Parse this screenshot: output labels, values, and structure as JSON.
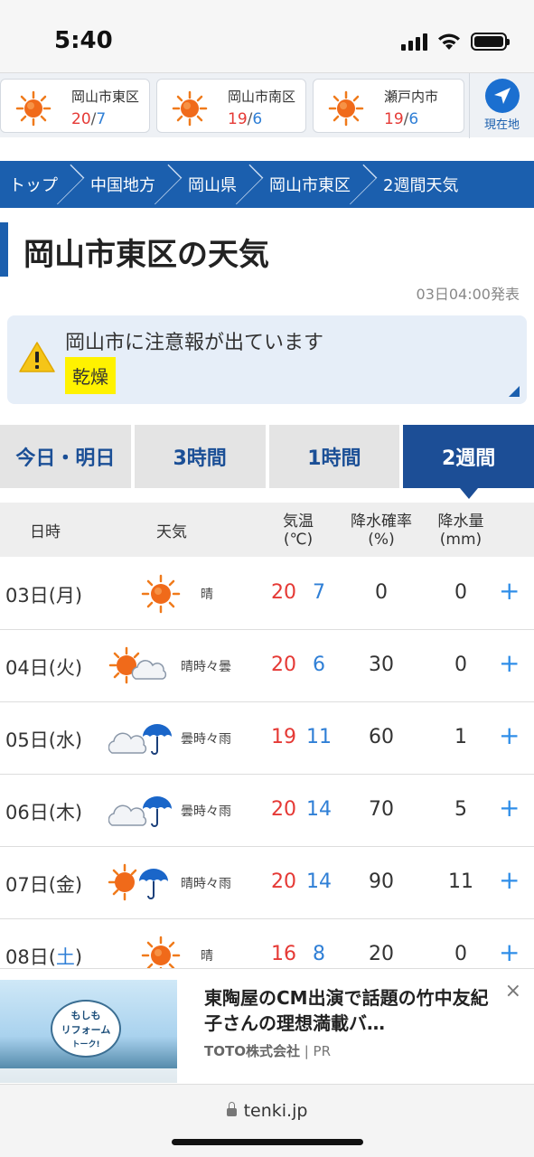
{
  "status_bar": {
    "time": "5:40"
  },
  "locations": [
    {
      "name": "岡山市東区",
      "high": "20",
      "low": "7"
    },
    {
      "name": "岡山市南区",
      "high": "19",
      "low": "6"
    },
    {
      "name": "瀬戸内市",
      "high": "19",
      "low": "6"
    }
  ],
  "current_location_label": "現在地",
  "breadcrumb": [
    "トップ",
    "中国地方",
    "岡山県",
    "岡山市東区",
    "2週間天気"
  ],
  "page_title": "岡山市東区の天気",
  "published": "03日04:00発表",
  "warning": {
    "message": "岡山市に注意報が出ています",
    "tag": "乾燥"
  },
  "tabs": [
    "今日・明日",
    "3時間",
    "1時間",
    "2週間"
  ],
  "active_tab": "2週間",
  "table_headers": {
    "date": "日時",
    "weather": "天気",
    "temp": "気温",
    "temp_unit": "(℃)",
    "precip_prob": "降水確率",
    "precip_prob_unit": "(%)",
    "precip_amt": "降水量",
    "precip_amt_unit": "(mm)"
  },
  "rows": [
    {
      "date": "03日(",
      "dow": "月",
      "close": ")",
      "weather": "晴",
      "icon": "sun-icon",
      "high": "20",
      "low": "7",
      "prob": "0",
      "amount": "0"
    },
    {
      "date": "04日(",
      "dow": "火",
      "close": ")",
      "weather": "晴時々曇",
      "icon": "sun-cloud-icon",
      "high": "20",
      "low": "6",
      "prob": "30",
      "amount": "0"
    },
    {
      "date": "05日(",
      "dow": "水",
      "close": ")",
      "weather": "曇時々雨",
      "icon": "cloud-umbrella-icon",
      "high": "19",
      "low": "11",
      "prob": "60",
      "amount": "1"
    },
    {
      "date": "06日(",
      "dow": "木",
      "close": ")",
      "weather": "曇時々雨",
      "icon": "cloud-umbrella-icon",
      "high": "20",
      "low": "14",
      "prob": "70",
      "amount": "5"
    },
    {
      "date": "07日(",
      "dow": "金",
      "close": ")",
      "weather": "晴時々雨",
      "icon": "sun-umbrella-icon",
      "high": "20",
      "low": "14",
      "prob": "90",
      "amount": "11"
    },
    {
      "date": "08日(",
      "dow": "土",
      "close": ")",
      "weather": "晴",
      "icon": "sun-icon",
      "high": "16",
      "low": "8",
      "prob": "20",
      "amount": "0"
    }
  ],
  "plus_label": "+",
  "ad": {
    "headline": "東陶屋のCM出演で話題の竹中友紀子さんの理想満載バ…",
    "sponsor": "TOTO株式会社",
    "sponsor_suffix": " | PR",
    "close": "×",
    "thumb_text_1": "もしも",
    "thumb_text_2": "リフォーム",
    "thumb_text_3": "トーク!"
  },
  "url": "tenki.jp",
  "colors": {
    "brand_blue": "#1b5fae",
    "high_temp": "#e53935",
    "low_temp": "#2f7fd6",
    "warning_tag": "#fff200"
  }
}
